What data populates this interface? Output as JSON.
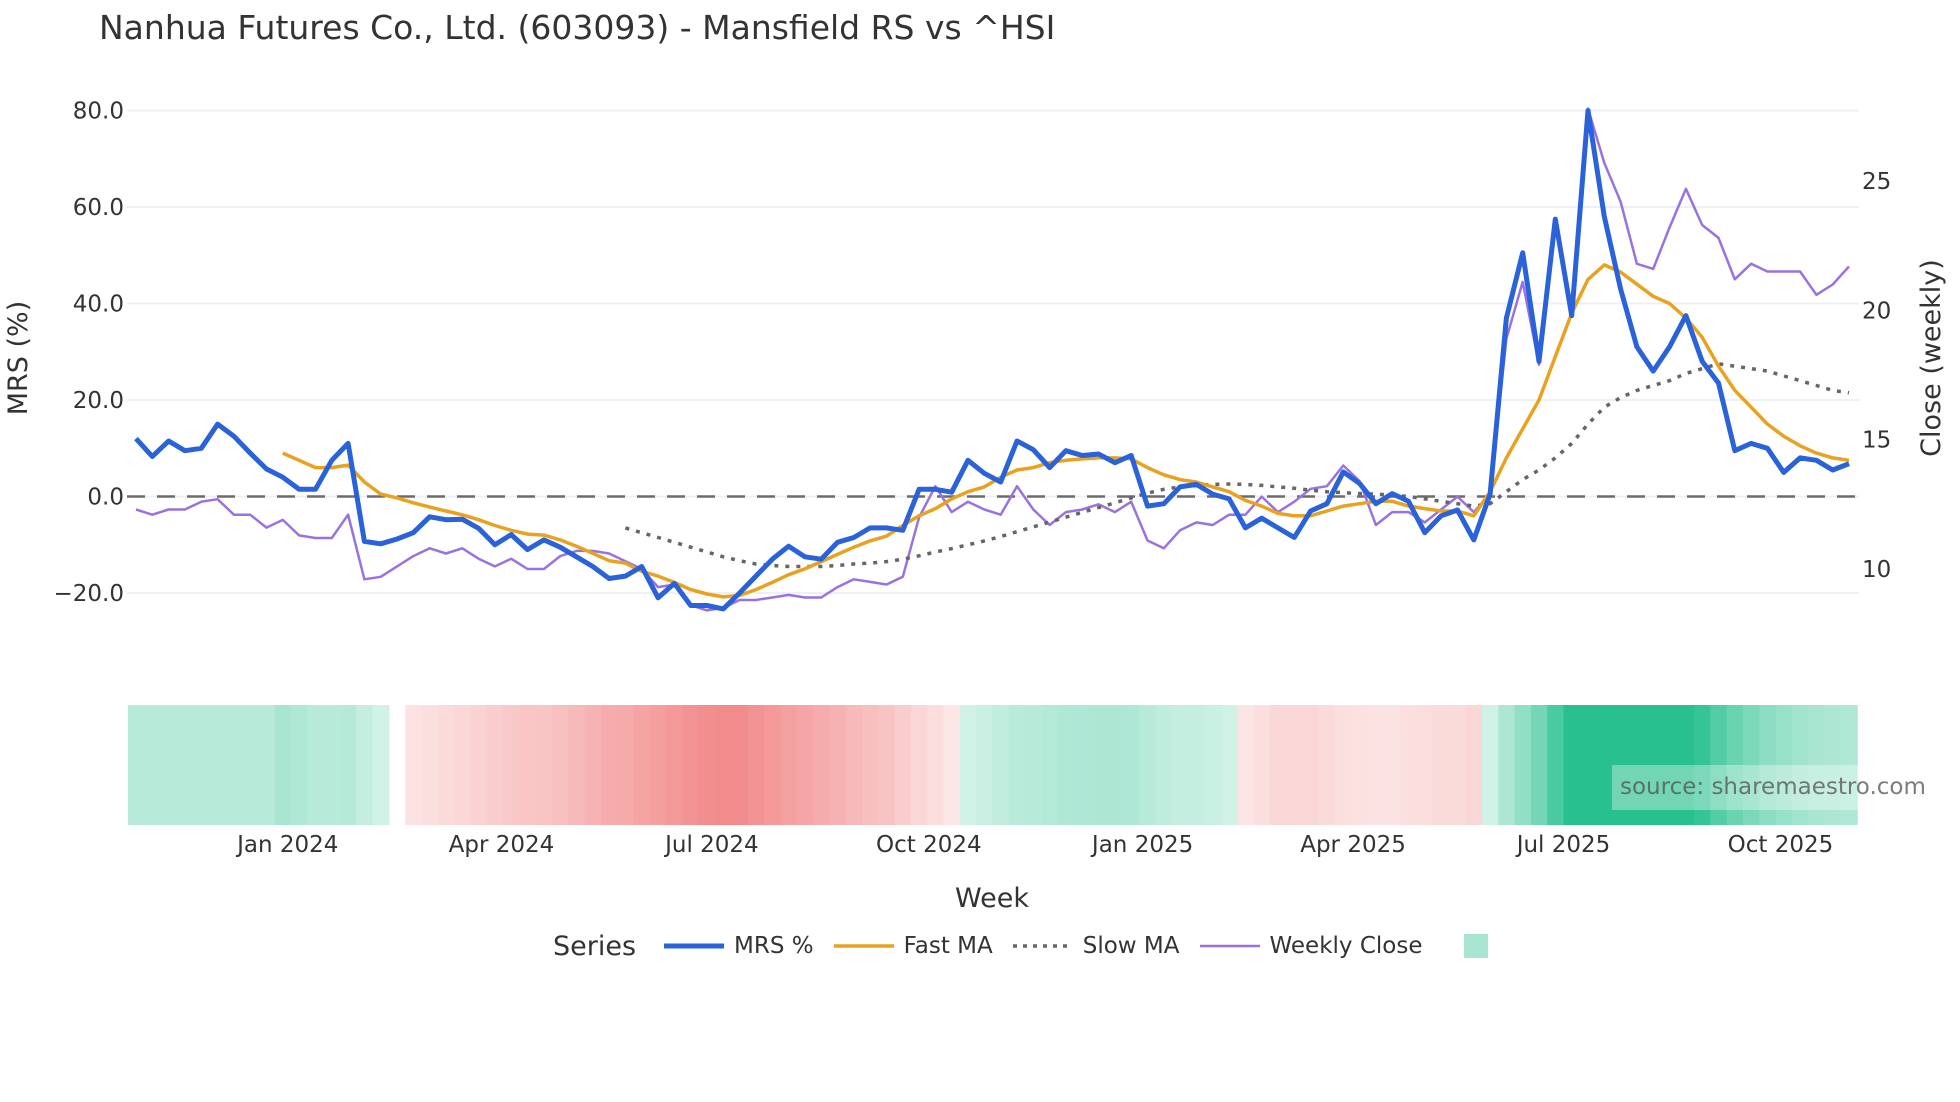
{
  "title": "Nanhua Futures Co., Ltd. (603093) - Mansfield RS vs ^HSI",
  "watermark": "source: sharemaestro.com",
  "colors": {
    "mrs": "#2a62d9",
    "fast": "#e8a21f",
    "slow": "#666666",
    "close": "#9a72e0",
    "pos": "#27c08e",
    "neg": "#f28b8b",
    "grid": "#eef0f5",
    "zero": "#6b6b6b"
  },
  "chart_data": {
    "type": "line",
    "title": "Nanhua Futures Co., Ltd. (603093) - Mansfield RS vs ^HSI",
    "xlabel": "Week",
    "ylabel": "MRS (%)",
    "y2label": "Close (weekly)",
    "ylim": [
      -32,
      90
    ],
    "y2lim": [
      6.3,
      29.9
    ],
    "yticks": [
      80,
      60,
      40,
      20,
      0,
      -20
    ],
    "ytick_labels": [
      "80.0",
      "60.0",
      "40.0",
      "20.0",
      "0.0",
      "−20.0"
    ],
    "y2ticks": [
      25,
      20,
      15,
      10
    ],
    "y2tick_labels": [
      "25",
      "20",
      "15",
      "10"
    ],
    "xticks": [
      {
        "label": "Jan 2024",
        "week_index": 9.3
      },
      {
        "label": "Apr 2024",
        "week_index": 22.4
      },
      {
        "label": "Jul 2024",
        "week_index": 35.3
      },
      {
        "label": "Oct 2024",
        "week_index": 48.6
      },
      {
        "label": "Jan 2025",
        "week_index": 61.7
      },
      {
        "label": "Apr 2025",
        "week_index": 74.6
      },
      {
        "label": "Jul 2025",
        "week_index": 87.5
      },
      {
        "label": "Oct 2025",
        "week_index": 100.8
      }
    ],
    "n_weeks": 106,
    "legend_title": "Series",
    "series": [
      {
        "name": "MRS %",
        "axis": "left",
        "values": [
          12,
          8.3,
          11.5,
          9.5,
          10,
          15,
          12.5,
          9,
          5.7,
          4,
          1.5,
          1.5,
          7.5,
          11,
          -9.3,
          -9.8,
          -8.8,
          -7.5,
          -4.2,
          -4.8,
          -4.7,
          -6.6,
          -10,
          -7.9,
          -11,
          -9,
          -10.5,
          -12.5,
          -14.5,
          -17,
          -16.5,
          -14.5,
          -21,
          -18,
          -22.6,
          -22.6,
          -23.3,
          -20,
          -16.5,
          -13,
          -10.3,
          -12.5,
          -13,
          -9.5,
          -8.5,
          -6.5,
          -6.5,
          -7,
          1.5,
          1.5,
          0.9,
          7.5,
          4.8,
          3,
          11.5,
          9.7,
          6,
          9.5,
          8.5,
          8.8,
          7,
          8.5,
          -2,
          -1.5,
          2,
          2.5,
          0.5,
          -0.5,
          -6.5,
          -4.5,
          -6.5,
          -8.5,
          -3,
          -1.5,
          5.1,
          2.7,
          -1.5,
          0.6,
          -1,
          -7.5,
          -4,
          -2.8,
          -9,
          0.5,
          37,
          50.5,
          28,
          57.5,
          37.5,
          80,
          58,
          43,
          31,
          26,
          31,
          37.5,
          28,
          23.5,
          9.5,
          11,
          10,
          5,
          8,
          7.5,
          5.5,
          6.8
        ]
      },
      {
        "name": "Fast MA",
        "axis": "left",
        "values": [
          null,
          null,
          null,
          null,
          null,
          null,
          null,
          null,
          null,
          9,
          7.5,
          6,
          6,
          6.5,
          3,
          0.5,
          -0.3,
          -1.3,
          -2.2,
          -3,
          -3.8,
          -4.8,
          -6,
          -7,
          -7.8,
          -8,
          -9,
          -10.3,
          -11.8,
          -13.3,
          -13.8,
          -15.5,
          -16.5,
          -17.8,
          -19.3,
          -20.2,
          -20.8,
          -20.5,
          -19.3,
          -17.8,
          -16.2,
          -15,
          -13.5,
          -12,
          -10.5,
          -9.2,
          -8.2,
          -6,
          -4,
          -2.5,
          -0.5,
          1,
          2,
          4,
          5.5,
          6,
          7,
          7.5,
          7.8,
          8,
          8,
          7.8,
          6,
          4.5,
          3.5,
          3,
          2,
          1,
          -0.8,
          -2,
          -3.5,
          -4,
          -4,
          -3,
          -2,
          -1.5,
          -1,
          -1,
          -2,
          -2.5,
          -3,
          -3,
          -4,
          1,
          8,
          14,
          20,
          29,
          38,
          45,
          48,
          46.5,
          44,
          41.5,
          40,
          37,
          33,
          27,
          22,
          18.5,
          15,
          12.5,
          10.5,
          9,
          8,
          7.5
        ]
      },
      {
        "name": "Slow MA",
        "axis": "left",
        "values": [
          null,
          null,
          null,
          null,
          null,
          null,
          null,
          null,
          null,
          null,
          null,
          null,
          null,
          null,
          null,
          null,
          null,
          null,
          null,
          null,
          null,
          null,
          null,
          null,
          null,
          null,
          null,
          null,
          null,
          null,
          -6.5,
          -7.5,
          -8.5,
          -9.5,
          -10.5,
          -11.5,
          -12.5,
          -13.3,
          -14,
          -14.3,
          -14.5,
          -14.5,
          -14.5,
          -14.3,
          -14,
          -13.8,
          -13.5,
          -13,
          -12.3,
          -11.5,
          -10.8,
          -10,
          -9.2,
          -8.3,
          -7.3,
          -6.3,
          -5.3,
          -4.3,
          -3.3,
          -2.3,
          -1.3,
          -0.3,
          0.7,
          1.5,
          2,
          2.3,
          2.5,
          2.6,
          2.5,
          2.3,
          2,
          1.7,
          1.3,
          1,
          0.8,
          0.6,
          0.5,
          0.3,
          0,
          -0.5,
          -1,
          -1.5,
          -2,
          -1.5,
          1,
          3.5,
          5.5,
          8,
          11,
          15,
          18.5,
          20.5,
          22,
          23,
          24,
          25.5,
          26.5,
          27.5,
          27,
          26.5,
          26,
          25,
          24,
          23,
          22,
          21.5
        ]
      },
      {
        "name": "Weekly Close",
        "axis": "right",
        "values": [
          12.3,
          12.1,
          12.3,
          12.3,
          12.6,
          12.7,
          12.1,
          12.1,
          11.6,
          11.9,
          11.3,
          11.2,
          11.2,
          12.1,
          9.6,
          9.7,
          10.1,
          10.5,
          10.8,
          10.6,
          10.8,
          10.4,
          10.1,
          10.4,
          10,
          10,
          10.5,
          10.7,
          10.7,
          10.6,
          10.3,
          10,
          9.3,
          9.4,
          8.6,
          8.4,
          8.5,
          8.8,
          8.8,
          8.9,
          9,
          8.9,
          8.9,
          9.3,
          9.6,
          9.5,
          9.4,
          9.7,
          12,
          13.2,
          12.2,
          12.6,
          12.3,
          12.1,
          13.2,
          12.3,
          11.7,
          12.2,
          12.3,
          12.5,
          12.2,
          12.6,
          11.1,
          10.8,
          11.5,
          11.8,
          11.7,
          12.1,
          12.1,
          12.8,
          12.2,
          12.6,
          13.1,
          13.2,
          14,
          13.4,
          11.7,
          12.2,
          12.2,
          11.8,
          12.3,
          12.8,
          12.2,
          12.9,
          18.9,
          21.1,
          17.9,
          23.5,
          20.1,
          27.8,
          25.7,
          24.2,
          21.8,
          21.6,
          23.2,
          24.7,
          23.3,
          22.8,
          21.2,
          21.8,
          21.5,
          21.5,
          21.5,
          20.6,
          21,
          21.7
        ]
      }
    ],
    "heatmap": {
      "source_series": "Fast MA",
      "fill_before_start": 6,
      "gap_week_index": 16
    }
  }
}
